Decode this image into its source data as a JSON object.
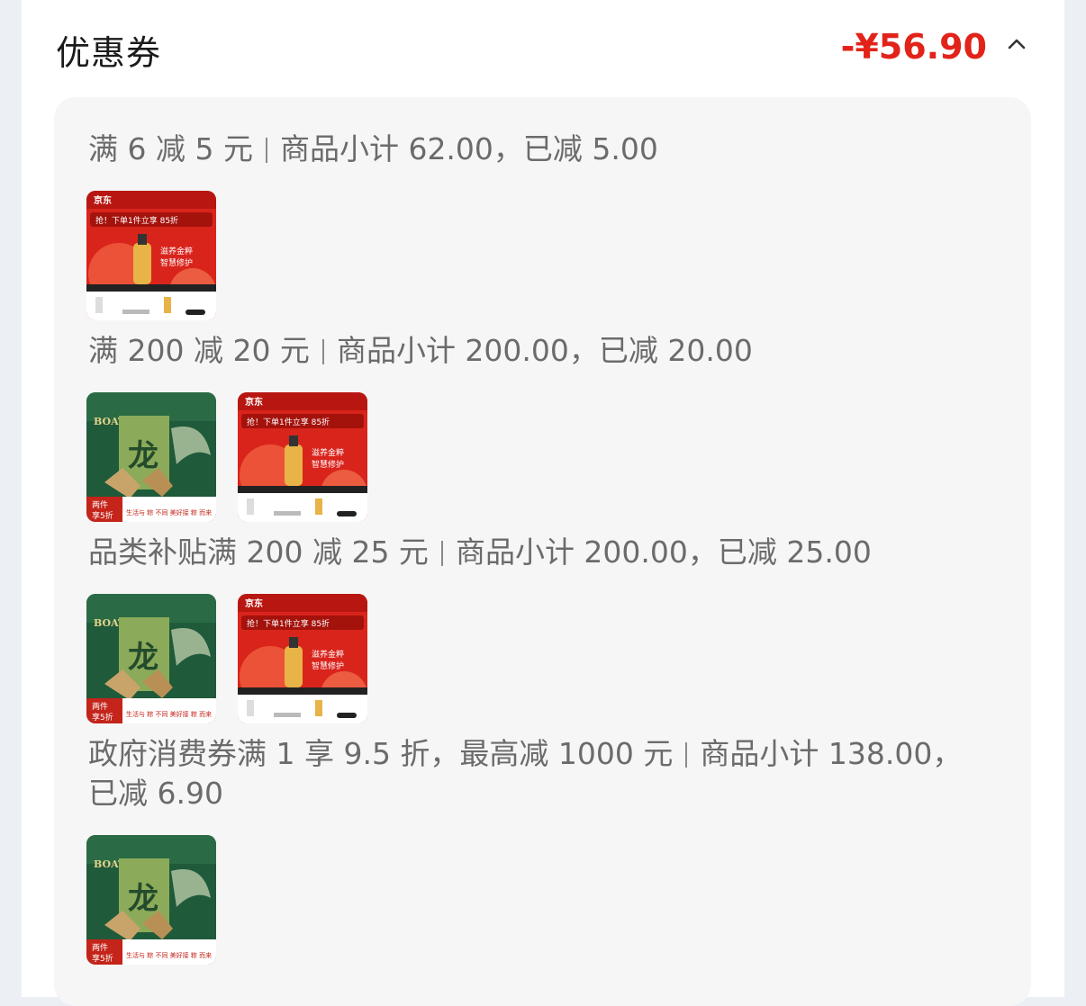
{
  "header": {
    "title": "优惠券",
    "total": "-¥56.90"
  },
  "coupons": [
    {
      "name": "满 6 减 5 元",
      "detail": "商品小计 62.00，已减 5.00",
      "items": [
        "beauty-oil-product"
      ]
    },
    {
      "name": "满 200 减 20 元",
      "detail": "商品小计 200.00，已减 20.00",
      "items": [
        "zongzi-gift-box-product",
        "beauty-oil-product"
      ]
    },
    {
      "name": "品类补贴满 200 减 25 元",
      "detail": "商品小计 200.00，已减 25.00",
      "items": [
        "zongzi-gift-box-product",
        "beauty-oil-product"
      ]
    },
    {
      "name": "政府消费券满 1 享 9.5 折，最高减 1000 元",
      "detail": "商品小计 138.00，",
      "detail_line2": "已减 6.90",
      "items": [
        "zongzi-gift-box-product"
      ]
    }
  ],
  "product_images": {
    "beauty": {
      "brand": "京东",
      "promo": "抢！下单1件立享 85折",
      "tagline1": "滋养金粹",
      "tagline2": "智慧修护"
    },
    "zongzi": {
      "brand": "BOAT",
      "chars": "龙",
      "badge1": "两件",
      "badge2": "享5折",
      "footer": "生活与 粽 不同 美好接 粽 而来"
    }
  },
  "colors": {
    "accent": "#e2231a",
    "panel": "#f6f6f6",
    "beauty_red": "#d9241c",
    "zongzi_green": "#1f5a3a"
  }
}
